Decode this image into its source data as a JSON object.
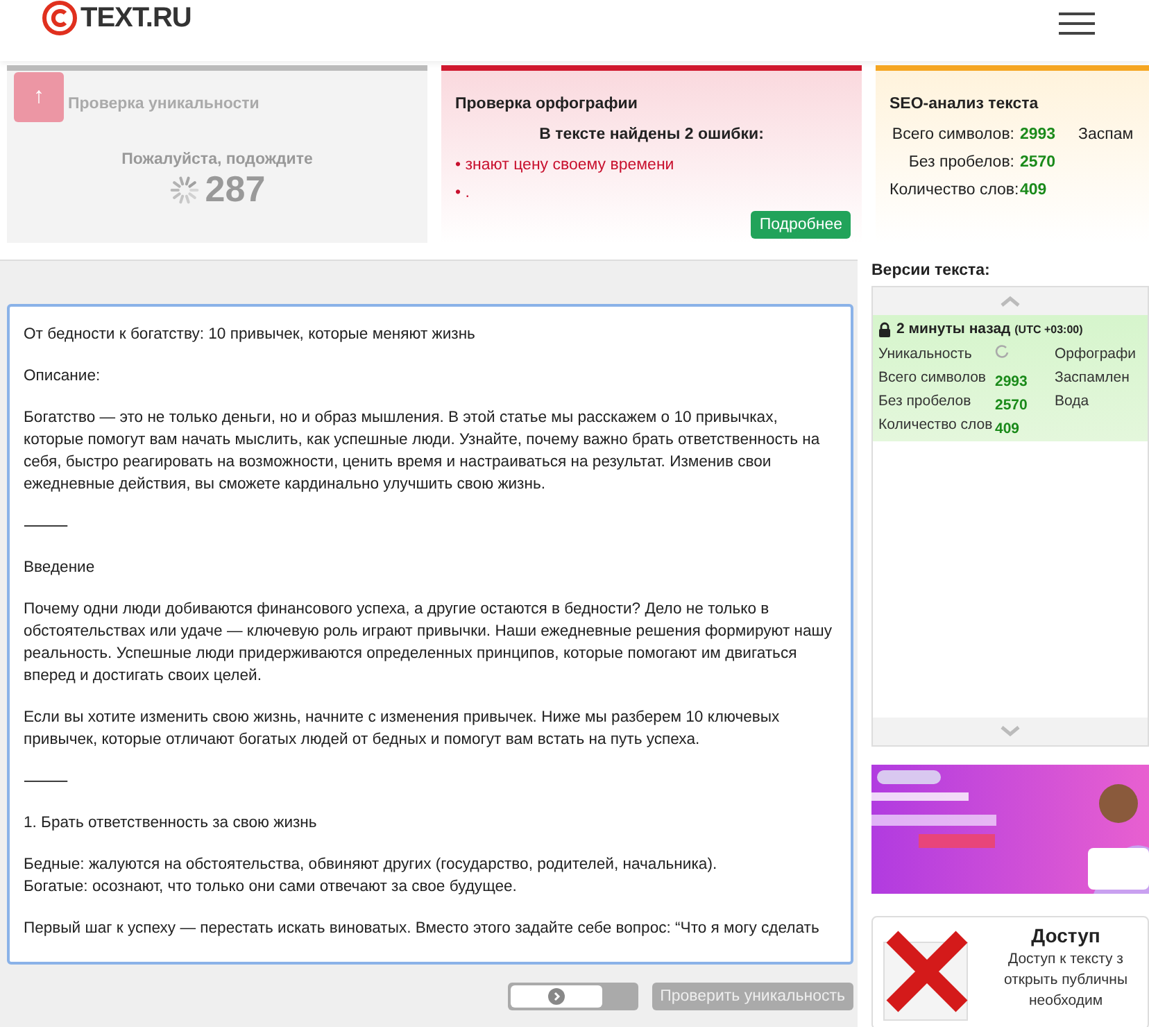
{
  "header": {
    "logo": "TEXT.RU"
  },
  "scroll_top_button": {
    "label": "↑"
  },
  "uniqueness_card": {
    "title": "Проверка уникальности",
    "status": "Пожалуйста, подождите",
    "counter": "287"
  },
  "spelling_card": {
    "title": "Проверка орфографии",
    "summary": "В тексте найдены 2 ошибки:",
    "errors": [
      {
        "marker": "•",
        "text": "знают цену своему времени"
      },
      {
        "marker": "•",
        "text": "."
      }
    ],
    "button": "Подробнее"
  },
  "seo_card": {
    "title": "SEO-анализ текста",
    "stats": [
      {
        "label": "Всего символов:",
        "value": "2993"
      },
      {
        "label": "Без пробелов:",
        "value": "2570"
      },
      {
        "label": "Количество слов:",
        "value": "409"
      }
    ],
    "extra_label": "Заспам"
  },
  "editor": {
    "paragraphs": [
      "От бедности к богатству: 10 привычек, которые меняют жизнь",
      "Описание:",
      "Богатство — это не только деньги, но и образ мышления. В этой статье мы расскажем о 10 привычках, которые помогут вам начать мыслить, как успешные люди. Узнайте, почему важно брать ответственность на себя, быстро реагировать на возможности, ценить время и настраиваться на результат. Изменив свои ежедневные действия, вы сможете кардинально улучшить свою жизнь.",
      "⸻",
      "Введение",
      "Почему одни люди добиваются финансового успеха, а другие остаются в бедности? Дело не только в обстоятельствах или удаче — ключевую роль играют привычки. Наши ежедневные решения формируют нашу реальность. Успешные люди придерживаются определенных принципов, которые помогают им двигаться вперед и достигать своих целей.",
      "Если вы хотите изменить свою жизнь, начните с изменения привычек. Ниже мы разберем 10 ключевых привычек, которые отличают богатых людей от бедных и помогут вам встать на путь успеха.",
      "⸻",
      "1. Брать ответственность за свою жизнь",
      "Бедные: жалуются на обстоятельства, обвиняют других (государство, родителей, начальника).\nБогатые: осознают, что только они сами отвечают за свое будущее.",
      "Первый шаг к успеху — перестать искать виноватых. Вместо этого задайте себе вопрос: “Что я могу сделать"
    ],
    "check_button": "Проверить уникальность",
    "switch": {
      "on": false
    }
  },
  "versions": {
    "title": "Версии текста:",
    "entries": [
      {
        "time": "2 минуты назад",
        "timezone": "(UTC +03:00)",
        "rows": [
          {
            "label": "Уникальность",
            "kind": "spinner",
            "label2": "Орфографи"
          },
          {
            "label": "Всего символов",
            "value": "2993",
            "kind": "value",
            "label2": "Заспамлен"
          },
          {
            "label": "Без пробелов",
            "value": "2570",
            "kind": "value",
            "label2": "Вода"
          },
          {
            "label": "Количество слов",
            "value": "409",
            "kind": "value"
          }
        ]
      }
    ]
  },
  "access_card": {
    "title": "Доступ",
    "lines": [
      "Доступ к тексту з",
      "открыть публичны",
      "необходим"
    ]
  }
}
